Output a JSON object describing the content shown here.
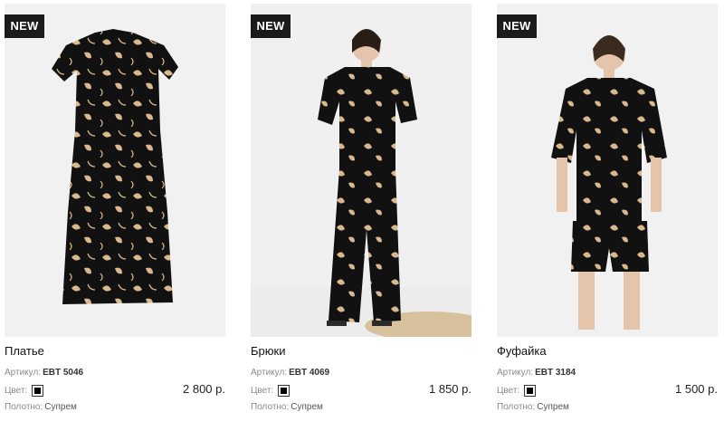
{
  "products": [
    {
      "badge": "NEW",
      "name": "Платье",
      "article_label": "Артикул:",
      "article": "EBT 5046",
      "color_label": "Цвет:",
      "color": "#000000",
      "price": "2 800 р.",
      "fabric_label": "Полотно:",
      "fabric": "Супрем",
      "image_icon": "dress-image"
    },
    {
      "badge": "NEW",
      "name": "Брюки",
      "article_label": "Артикул:",
      "article": "EBT 4069",
      "color_label": "Цвет:",
      "color": "#000000",
      "price": "1 850 р.",
      "fabric_label": "Полотно:",
      "fabric": "Супрем",
      "image_icon": "pants-model-image"
    },
    {
      "badge": "NEW",
      "name": "Фуфайка",
      "article_label": "Артикул:",
      "article": "EBT 3184",
      "color_label": "Цвет:",
      "color": "#000000",
      "price": "1 500 р.",
      "fabric_label": "Полотно:",
      "fabric": "Супрем",
      "image_icon": "tshirt-model-image"
    }
  ],
  "colors": {
    "print_base": "#111111",
    "print_motif": "#d8b88c",
    "badge_bg": "#1b1b1b"
  }
}
